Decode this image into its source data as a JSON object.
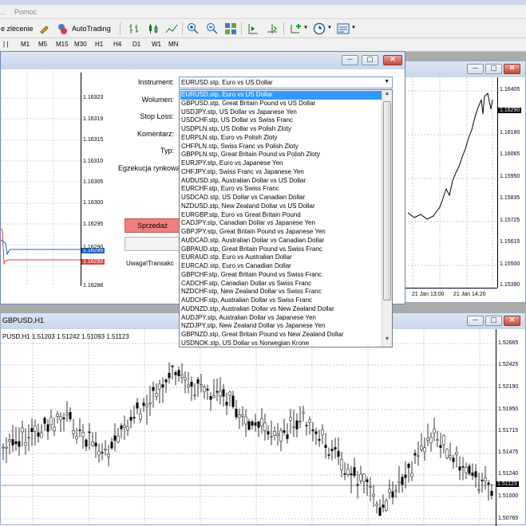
{
  "menu": {
    "item_1": "Pomoc"
  },
  "toolbar": {
    "new_order": "e zlecenie",
    "autotrading": "AutoTrading",
    "timeframes": [
      "M1",
      "M5",
      "M15",
      "M30",
      "H1",
      "H4",
      "D1",
      "W1",
      "MN"
    ]
  },
  "chart_eurusd": {
    "prices": [
      "1.16323",
      "1.16319",
      "1.16315",
      "1.16310",
      "1.16305",
      "1.16300",
      "1.16295",
      "1.16290",
      "1.16288"
    ],
    "bid_tag": "1.16295",
    "ask_tag": "1.16293"
  },
  "dialog": {
    "instrument_label": "Instrument:",
    "volume_label": "Wolumen:",
    "stoploss_label": "Stop Loss:",
    "comment_label": "Komentarz:",
    "type_label": "Typ:",
    "execution_label": "Egzekucja rynkowa",
    "sell_button": "Sprzedaż",
    "warning": "Uwaga!Transakc",
    "selected_instrument": "EURUSD.stp, Euro vs US Dollar",
    "instruments": [
      "EURUSD.stp, Euro vs US Dollar",
      "GBPUSD.stp, Great Britain Pound vs US Dollar",
      "USDJPY.stp, US Dollar vs Japanese Yen",
      "USDCHF.stp, US Dollar vs Swiss Franc",
      "USDPLN.stp, US Dollar vs Polish Zloty",
      "EURPLN.stp, Euro vs Polish Zloty",
      "CHFPLN.stp, Swiss Franc vs Polish Zloty",
      "GBPPLN.stp, Great Britain Pound vs Polish Zloty",
      "EURJPY.stp, Euro vs Japanese Yen",
      "CHFJPY.stp, Swiss Franc vs Japanese Yen",
      "AUDUSD.stp, Australian Dollar vs US Dollar",
      "EURCHF.stp, Euro vs Swiss Franc",
      "USDCAD.stp, US Dollar vs Canadian Dollar",
      "NZDUSD.stp, New Zealand Dollar vs US Dollar",
      "EURGBP.stp, Euro vs Great Britain Pound",
      "CADJPY.stp, Canadian Dollar vs Japanese Yen",
      "GBPJPY.stp, Great Britain Pound vs Japanese Yen",
      "AUDCAD.stp, Australian Dollar vs Canadian Dollar",
      "GBPAUD.stp, Great Britain Pound vs Swiss Franc",
      "EURAUD.stp, Euro vs Australian Dollar",
      "EURCAD.stp, Euro vs Canadian Dollar",
      "GBPCHF.stp, Great Britain Pound vs Swiss Franc",
      "CADCHF.stp, Canadian Dollar vs Swiss Franc",
      "NZDCHF.stp, New Zealand Dollar vs Swiss Franc",
      "AUDCHF.stp, Australian Dollar vs Swiss Franc",
      "AUDNZD.stp, Australian Dollar vs New Zealand Dollar",
      "AUDJPY.stp, Australian Dollar vs Japanese Yen",
      "NZDJPY.stp, New Zealand Dollar vs Japanese Yen",
      "GBPNZD.stp, Great Britain Pound vs New Zealand Dollar",
      "USDNOK.stp, US Dollar vs Norwegian Krone"
    ]
  },
  "chart_right": {
    "prices": [
      "1.16405",
      "1.16290",
      "1.16180",
      "1.16065",
      "1.15950",
      "1.15835",
      "1.15725",
      "1.15615",
      "1.15500",
      "1.15390"
    ],
    "current_tag": "1.16290",
    "dates": [
      "21 Jan 13:00",
      "21 Jan 14:20"
    ]
  },
  "chart_gbpusd": {
    "window_title": "GBPUSD,H1",
    "ohlc_header": "PUSD,H1  1.51203 1.51242 1.51093 1.51123",
    "prices": [
      "1.52665",
      "1.52425",
      "1.52190",
      "1.51950",
      "1.51715",
      "1.51475",
      "1.51240",
      "1.51123",
      "1.51000",
      "1.50765"
    ],
    "current_tag": "1.51123"
  },
  "colors": {
    "sell": "#f08080",
    "selection": "#3399ff",
    "chart_line": "#000000"
  }
}
